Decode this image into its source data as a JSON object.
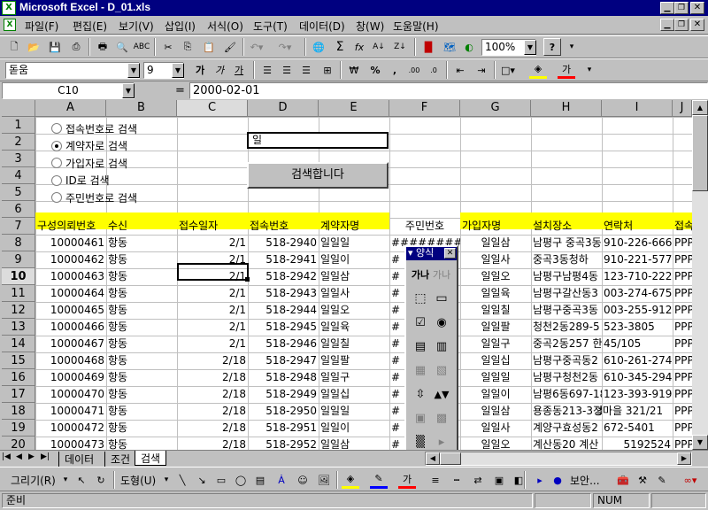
{
  "window": {
    "title": "Microsoft Excel - D_01.xls"
  },
  "menu": [
    "파일(F)",
    "편집(E)",
    "보기(V)",
    "삽입(I)",
    "서식(O)",
    "도구(T)",
    "데이터(D)",
    "창(W)",
    "도움말(H)"
  ],
  "toolbar": {
    "zoom": "100%"
  },
  "format": {
    "font": "돋움",
    "size": "9"
  },
  "formula": {
    "cellref": "C10",
    "eq": "=",
    "value": "2000-02-01"
  },
  "columns": [
    "A",
    "B",
    "C",
    "D",
    "E",
    "F",
    "G",
    "H",
    "I",
    "J"
  ],
  "rows": [
    "1",
    "2",
    "3",
    "4",
    "5",
    "6",
    "7",
    "8",
    "9",
    "10",
    "11",
    "12",
    "13",
    "14",
    "15",
    "16",
    "17",
    "18",
    "19",
    "20"
  ],
  "options": [
    {
      "label": "접속번호로 검색",
      "on": false
    },
    {
      "label": "계약자로 검색",
      "on": true
    },
    {
      "label": "가입자로 검색",
      "on": false
    },
    {
      "label": "ID로 검색",
      "on": false
    },
    {
      "label": "주민번호로 검색",
      "on": false
    }
  ],
  "search": {
    "value": "일",
    "button": "검색합니다"
  },
  "headers": [
    "구성의뢰번호",
    "수신",
    "접수일자",
    "접속번호",
    "계약자명",
    "주민번호",
    "가입자명",
    "설치장소",
    "연락처",
    "접속"
  ],
  "data": [
    [
      "10000461",
      "항동",
      "2/1",
      "518-2940",
      "일일일",
      "#########",
      "일일삼",
      "남평구 중곡3동",
      "910-226-6669",
      "PPP"
    ],
    [
      "10000462",
      "항동",
      "2/1",
      "518-2941",
      "일일이",
      "#",
      "일일사",
      "중곡3동청하",
      "910-221-5776",
      "PPP"
    ],
    [
      "10000463",
      "항동",
      "2/1",
      "518-2942",
      "일일삼",
      "#",
      "일일오",
      "남평구남평4동",
      "123-710-2224",
      "PPP"
    ],
    [
      "10000464",
      "항동",
      "2/1",
      "518-2943",
      "일일사",
      "#",
      "일일육",
      "남평구갈산동3",
      "003-274-6757",
      "PPP"
    ],
    [
      "10000465",
      "항동",
      "2/1",
      "518-2944",
      "일일오",
      "#",
      "일일칠",
      "남평구중곡3동",
      "003-255-9128",
      "PPP"
    ],
    [
      "10000466",
      "항동",
      "2/1",
      "518-2945",
      "일일육",
      "#",
      "일일팔",
      "청천2동289-5",
      "523-3805",
      "PPP"
    ],
    [
      "10000467",
      "항동",
      "2/1",
      "518-2946",
      "일일칠",
      "#",
      "일일구",
      "중곡2동257 한양",
      "45/105",
      "PPP"
    ],
    [
      "10000468",
      "항동",
      "2/18",
      "518-2947",
      "일일팔",
      "#",
      "일일십",
      "남평구중곡동2",
      "610-261-2747",
      "PPP"
    ],
    [
      "10000469",
      "항동",
      "2/18",
      "518-2948",
      "일일구",
      "#",
      "일일일",
      "남평구청천2동",
      "610-345-2945",
      "PPP"
    ],
    [
      "10000470",
      "항동",
      "2/18",
      "518-2949",
      "일일십",
      "#",
      "일일이",
      "남평6동697-18",
      "123-393-9195",
      "PPP"
    ],
    [
      "10000471",
      "항동",
      "2/18",
      "518-2950",
      "일일일",
      "#",
      "일일삼",
      "용종동213-3 초",
      "정마을 321/21",
      "PPP"
    ],
    [
      "10000472",
      "항동",
      "2/18",
      "518-2951",
      "일일이",
      "#",
      "일일사",
      "계양구효성동2",
      "672-5401",
      "PPP"
    ],
    [
      "10000473",
      "항동",
      "2/18",
      "518-2952",
      "일일삼",
      "#",
      "일일오",
      "계산동20 계산",
      "5192524",
      "PPP"
    ]
  ],
  "palette": {
    "title": "양식",
    "label1": "가나",
    "label2": "가나"
  },
  "sheets": [
    "데이터",
    "조건",
    "검색"
  ],
  "drawing": {
    "draw": "그리기(R)",
    "shapes": "도형(U)",
    "security": "보안..."
  },
  "status": {
    "left": "준비",
    "num": "NUM"
  }
}
